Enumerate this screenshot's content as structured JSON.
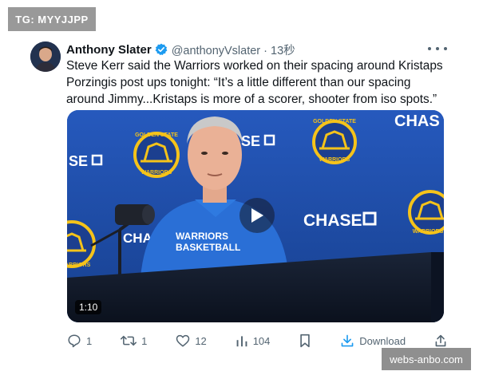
{
  "watermark_top": "TG: MYYJJPP",
  "watermark_bottom": "webs-anbo.com",
  "tweet": {
    "author_name": "Anthony Slater",
    "handle_time": "@anthonyVslater · 13秒",
    "text": "Steve Kerr said the Warriors worked on their spacing around Kristaps Porzingis post ups tonight: “It’s a little different than our spacing around Jimmy...Kristaps is more of a scorer, shooter from iso spots.”"
  },
  "video": {
    "duration": "1:10",
    "background_text": {
      "chase_top_right": "CHAS",
      "sec_left": "SE",
      "sec_middle": "SE",
      "chase_middle": "CHASE",
      "chase_left": "CHA",
      "shirt_line1": "WARRIORS",
      "shirt_line2": "BASKETBALL",
      "logo_top": "GOLDEN STATE",
      "logo_bottom": "WARRIORS"
    }
  },
  "actions": {
    "replies": "1",
    "reposts": "1",
    "likes": "12",
    "views": "104",
    "download_label": "Download"
  },
  "colors": {
    "verified": "#1d9bf0",
    "court_blue": "#1d4ba8",
    "warriors_gold": "#f5c31a"
  },
  "icons": [
    "verified-badge-icon",
    "more-icon",
    "play-icon",
    "reply-icon",
    "repost-icon",
    "like-icon",
    "views-icon",
    "bookmark-icon",
    "download-icon",
    "share-icon"
  ]
}
